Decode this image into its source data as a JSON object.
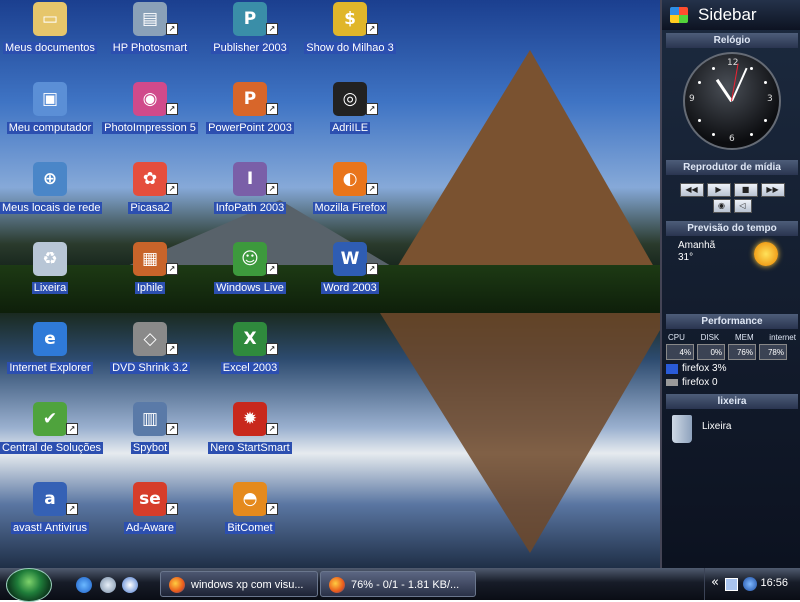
{
  "desktop": {
    "icons": [
      {
        "label": "Meus documentos",
        "icon": "folder-icon",
        "color": "#e6c66b",
        "glyph": "▭",
        "shortcut": false
      },
      {
        "label": "HP Photosmart",
        "icon": "hp-photosmart-icon",
        "color": "#8aa1b8",
        "glyph": "▤",
        "shortcut": true
      },
      {
        "label": "Publisher 2003",
        "icon": "publisher-icon",
        "color": "#3a8ea8",
        "glyph": "P",
        "shortcut": true
      },
      {
        "label": "Show do Milhao 3",
        "icon": "show-do-milhao-icon",
        "color": "#e0b62a",
        "glyph": "$",
        "shortcut": true
      },
      {
        "label": "Meu computador",
        "icon": "computer-icon",
        "color": "#5b8fd6",
        "glyph": "▣",
        "shortcut": false
      },
      {
        "label": "PhotoImpression 5",
        "icon": "photoimpression-icon",
        "color": "#d04a8b",
        "glyph": "◉",
        "shortcut": true
      },
      {
        "label": "PowerPoint 2003",
        "icon": "powerpoint-icon",
        "color": "#d8662a",
        "glyph": "P",
        "shortcut": true
      },
      {
        "label": "AdriILE",
        "icon": "adrile-icon",
        "color": "#222",
        "glyph": "◎",
        "shortcut": true
      },
      {
        "label": "Meus locais de rede",
        "icon": "network-icon",
        "color": "#4a86c8",
        "glyph": "⊕",
        "shortcut": false
      },
      {
        "label": "Picasa2",
        "icon": "picasa-icon",
        "color": "#e54e3d",
        "glyph": "✿",
        "shortcut": true
      },
      {
        "label": "InfoPath 2003",
        "icon": "infopath-icon",
        "color": "#7a5fa8",
        "glyph": "I",
        "shortcut": true
      },
      {
        "label": "Mozilla Firefox",
        "icon": "firefox-icon",
        "color": "#e9751b",
        "glyph": "◐",
        "shortcut": true
      },
      {
        "label": "Lixeira",
        "icon": "recycle-bin-icon",
        "color": "#b8c6d6",
        "glyph": "♻",
        "shortcut": false
      },
      {
        "label": "Iphile",
        "icon": "iphile-icon",
        "color": "#c8642a",
        "glyph": "▦",
        "shortcut": true
      },
      {
        "label": "Windows Live",
        "icon": "windows-live-icon",
        "color": "#3d9a3d",
        "glyph": "☺",
        "shortcut": true
      },
      {
        "label": "Word 2003",
        "icon": "word-icon",
        "color": "#2f5db3",
        "glyph": "W",
        "shortcut": true
      },
      {
        "label": "Internet Explorer",
        "icon": "internet-explorer-icon",
        "color": "#2f7ad8",
        "glyph": "e",
        "shortcut": false
      },
      {
        "label": "DVD Shrink 3.2",
        "icon": "dvd-shrink-icon",
        "color": "#8a8a8a",
        "glyph": "◇",
        "shortcut": true
      },
      {
        "label": "Excel 2003",
        "icon": "excel-icon",
        "color": "#2f8a3d",
        "glyph": "X",
        "shortcut": true
      },
      {
        "label": "Central de Soluções",
        "icon": "central-solucoes-icon",
        "color": "#4fa33d",
        "glyph": "✔",
        "shortcut": true
      },
      {
        "label": "Spybot",
        "icon": "spybot-icon",
        "color": "#5a7aa8",
        "glyph": "▥",
        "shortcut": true
      },
      {
        "label": "Nero StartSmart",
        "icon": "nero-icon",
        "color": "#c8281d",
        "glyph": "✹",
        "shortcut": true
      },
      {
        "label": "avast! Antivirus",
        "icon": "avast-icon",
        "color": "#3561b5",
        "glyph": "a",
        "shortcut": true
      },
      {
        "label": "Ad-Aware",
        "icon": "ad-aware-icon",
        "color": "#d63d2a",
        "glyph": "se",
        "shortcut": true
      },
      {
        "label": "BitComet",
        "icon": "bitcomet-icon",
        "color": "#e58a1d",
        "glyph": "◓",
        "shortcut": true
      }
    ]
  },
  "sidebar": {
    "title": "Sidebar",
    "clock": {
      "header": "Relógio",
      "n12": "12",
      "n3": "3",
      "n6": "6",
      "n9": "9",
      "time": "16:56"
    },
    "media": {
      "header": "Reprodutor de mídia",
      "buttons": [
        "◀◀",
        "▶",
        "■",
        "▶▶"
      ],
      "extra": [
        "◉",
        "◁"
      ]
    },
    "weather": {
      "header": "Previsão do tempo",
      "day": "Amanhã",
      "temp": "31°"
    },
    "performance": {
      "header": "Performance",
      "labels": [
        "CPU",
        "DISK",
        "MEM",
        "internet"
      ],
      "values": [
        "4%",
        "0%",
        "76%",
        "78%"
      ],
      "processes": [
        "firefox 3%",
        "firefox 0"
      ]
    },
    "recycle": {
      "header": "lixeira",
      "label": "Lixeira"
    }
  },
  "taskbar": {
    "buttons": [
      {
        "label": "windows xp com visu..."
      },
      {
        "label": "76% - 0/1 - 1.81 KB/..."
      }
    ],
    "clock": "16:56",
    "tray_chevron": "«"
  }
}
